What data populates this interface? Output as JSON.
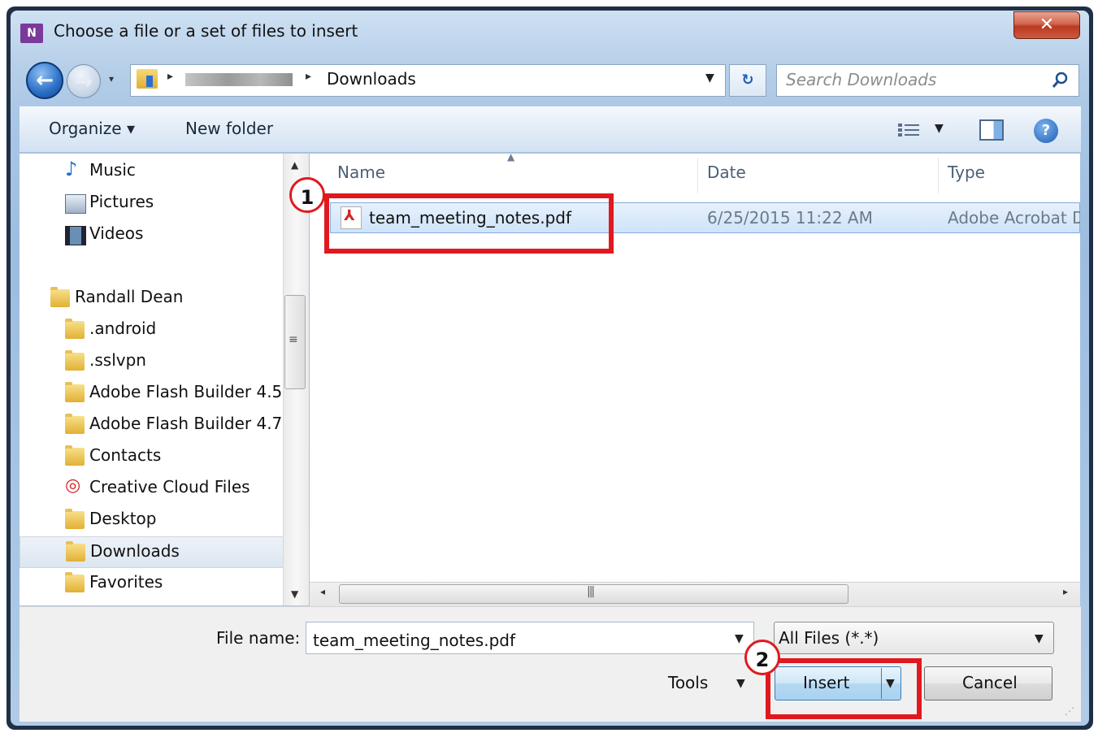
{
  "window": {
    "title": "Choose a file or a set of files to insert",
    "app_icon": "N",
    "close_glyph": "✕"
  },
  "address": {
    "crumb": "Downloads",
    "search_placeholder": "Search Downloads"
  },
  "toolbar": {
    "organize": "Organize ▾",
    "new_folder": "New folder",
    "help": "?"
  },
  "nav": {
    "items": [
      {
        "label": "Music",
        "icon": "music-icon"
      },
      {
        "label": "Pictures",
        "icon": "pictures-icon"
      },
      {
        "label": "Videos",
        "icon": "videos-icon"
      },
      {
        "label": "Randall Dean",
        "icon": "user-folder-icon"
      },
      {
        "label": ".android",
        "icon": "folder-icon"
      },
      {
        "label": ".sslvpn",
        "icon": "folder-icon"
      },
      {
        "label": "Adobe Flash Builder 4.5",
        "icon": "folder-icon"
      },
      {
        "label": "Adobe Flash Builder 4.7",
        "icon": "folder-icon"
      },
      {
        "label": "Contacts",
        "icon": "contacts-icon"
      },
      {
        "label": "Creative Cloud Files",
        "icon": "creative-cloud-icon"
      },
      {
        "label": "Desktop",
        "icon": "desktop-folder-icon"
      },
      {
        "label": "Downloads",
        "icon": "downloads-folder-icon"
      },
      {
        "label": "Favorites",
        "icon": "favorites-folder-icon"
      }
    ]
  },
  "columns": {
    "name": "Name",
    "date": "Date",
    "type": "Type"
  },
  "files": [
    {
      "name": "team_meeting_notes.pdf",
      "date": "6/25/2015 11:22 AM",
      "type": "Adobe Acrobat D"
    }
  ],
  "bottom": {
    "file_name_label": "File name:",
    "file_name_value": "team_meeting_notes.pdf",
    "filter": "All Files (*.*)",
    "tools": "Tools",
    "insert": "Insert",
    "cancel": "Cancel"
  },
  "annotations": {
    "step1": "1",
    "step2": "2",
    "color": "#e0191f"
  }
}
